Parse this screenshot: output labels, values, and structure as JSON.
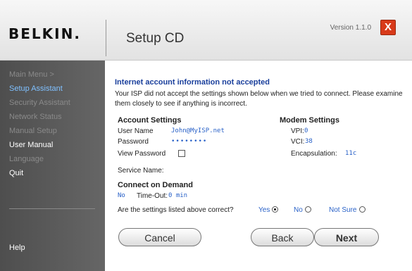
{
  "header": {
    "brand": "BELKIN.",
    "title": "Setup CD",
    "version": "Version 1.1.0",
    "close_label": "X"
  },
  "sidebar": {
    "items": [
      {
        "label": "Main Menu  >"
      },
      {
        "label": "Setup Assistant"
      },
      {
        "label": "Security Assistant"
      },
      {
        "label": "Network Status"
      },
      {
        "label": "Manual Setup"
      },
      {
        "label": "User Manual"
      },
      {
        "label": "Language"
      },
      {
        "label": "Quit"
      }
    ],
    "help": "Help"
  },
  "main": {
    "heading": "Internet account information not accepted",
    "message_line1": "Your ISP did not accept the settings shown below when we tried to connect. Please examine",
    "message_line2": "them closely to see if anything is incorrect.",
    "account": {
      "heading": "Account Settings",
      "username_label": "User Name",
      "username_value": "John@MyISP.net",
      "password_label": "Password",
      "password_value": "••••••••",
      "view_password_label": "View Password",
      "service_name_label": "Service Name:"
    },
    "modem": {
      "heading": "Modem Settings",
      "vpi_label": "VPI:",
      "vpi_value": "0",
      "vci_label": "VCI:",
      "vci_value": "38",
      "encap_label": "Encapsulation:",
      "encap_value": "11c"
    },
    "cod": {
      "heading": "Connect on Demand",
      "value": "No",
      "timeout_label": "Time-Out:",
      "timeout_value": "0 min"
    },
    "question": "Are the settings listed above correct?",
    "options": {
      "yes": "Yes",
      "no": "No",
      "not_sure": "Not Sure"
    }
  },
  "buttons": {
    "cancel": "Cancel",
    "back": "Back",
    "next": "Next"
  }
}
